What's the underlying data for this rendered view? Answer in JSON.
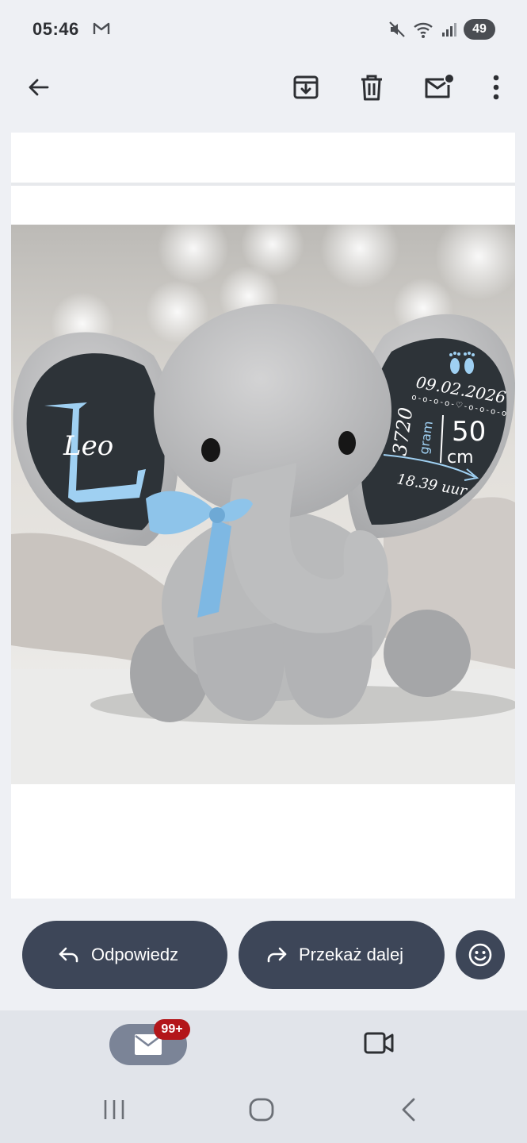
{
  "status_bar": {
    "time": "05:46",
    "battery": "49"
  },
  "toolbar": {
    "back": "arrow-left-icon",
    "archive": "archive-icon",
    "delete": "trash-icon",
    "mark_unread": "mail-unread-icon",
    "more": "more-vert-icon"
  },
  "image": {
    "name_text": "Leo",
    "date": "09.02.2026",
    "weight_value": "3720",
    "weight_unit": "gram",
    "length_value": "50",
    "length_unit": "cm",
    "time": "18.39 uur"
  },
  "actions": {
    "reply_label": "Odpowiedz",
    "forward_label": "Przekaż dalej"
  },
  "bottom_nav": {
    "mail_badge": "99+"
  },
  "colors": {
    "pill": "#3d4658",
    "badge": "#b3161a",
    "accent_blue": "#9fd0f2"
  }
}
